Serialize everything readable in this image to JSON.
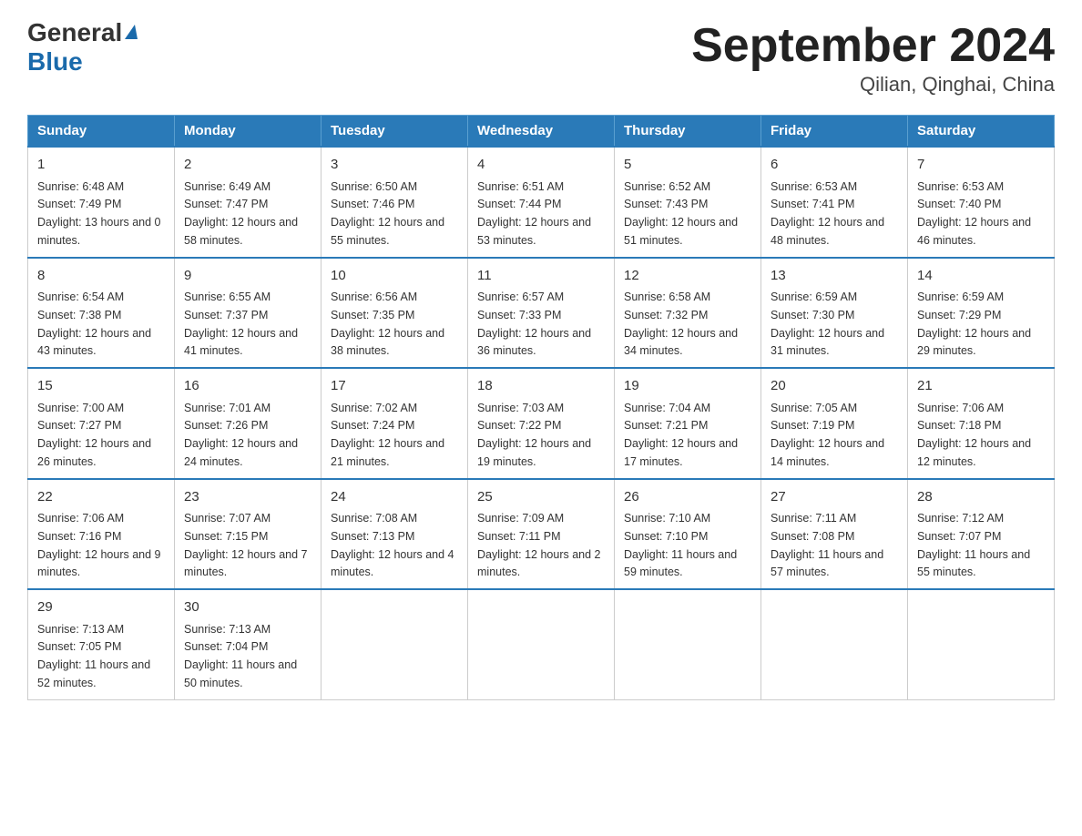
{
  "header": {
    "title": "September 2024",
    "subtitle": "Qilian, Qinghai, China",
    "logo": {
      "general": "General",
      "blue": "Blue"
    }
  },
  "days_of_week": [
    "Sunday",
    "Monday",
    "Tuesday",
    "Wednesday",
    "Thursday",
    "Friday",
    "Saturday"
  ],
  "weeks": [
    [
      {
        "day": "1",
        "sunrise": "6:48 AM",
        "sunset": "7:49 PM",
        "daylight": "13 hours and 0 minutes."
      },
      {
        "day": "2",
        "sunrise": "6:49 AM",
        "sunset": "7:47 PM",
        "daylight": "12 hours and 58 minutes."
      },
      {
        "day": "3",
        "sunrise": "6:50 AM",
        "sunset": "7:46 PM",
        "daylight": "12 hours and 55 minutes."
      },
      {
        "day": "4",
        "sunrise": "6:51 AM",
        "sunset": "7:44 PM",
        "daylight": "12 hours and 53 minutes."
      },
      {
        "day": "5",
        "sunrise": "6:52 AM",
        "sunset": "7:43 PM",
        "daylight": "12 hours and 51 minutes."
      },
      {
        "day": "6",
        "sunrise": "6:53 AM",
        "sunset": "7:41 PM",
        "daylight": "12 hours and 48 minutes."
      },
      {
        "day": "7",
        "sunrise": "6:53 AM",
        "sunset": "7:40 PM",
        "daylight": "12 hours and 46 minutes."
      }
    ],
    [
      {
        "day": "8",
        "sunrise": "6:54 AM",
        "sunset": "7:38 PM",
        "daylight": "12 hours and 43 minutes."
      },
      {
        "day": "9",
        "sunrise": "6:55 AM",
        "sunset": "7:37 PM",
        "daylight": "12 hours and 41 minutes."
      },
      {
        "day": "10",
        "sunrise": "6:56 AM",
        "sunset": "7:35 PM",
        "daylight": "12 hours and 38 minutes."
      },
      {
        "day": "11",
        "sunrise": "6:57 AM",
        "sunset": "7:33 PM",
        "daylight": "12 hours and 36 minutes."
      },
      {
        "day": "12",
        "sunrise": "6:58 AM",
        "sunset": "7:32 PM",
        "daylight": "12 hours and 34 minutes."
      },
      {
        "day": "13",
        "sunrise": "6:59 AM",
        "sunset": "7:30 PM",
        "daylight": "12 hours and 31 minutes."
      },
      {
        "day": "14",
        "sunrise": "6:59 AM",
        "sunset": "7:29 PM",
        "daylight": "12 hours and 29 minutes."
      }
    ],
    [
      {
        "day": "15",
        "sunrise": "7:00 AM",
        "sunset": "7:27 PM",
        "daylight": "12 hours and 26 minutes."
      },
      {
        "day": "16",
        "sunrise": "7:01 AM",
        "sunset": "7:26 PM",
        "daylight": "12 hours and 24 minutes."
      },
      {
        "day": "17",
        "sunrise": "7:02 AM",
        "sunset": "7:24 PM",
        "daylight": "12 hours and 21 minutes."
      },
      {
        "day": "18",
        "sunrise": "7:03 AM",
        "sunset": "7:22 PM",
        "daylight": "12 hours and 19 minutes."
      },
      {
        "day": "19",
        "sunrise": "7:04 AM",
        "sunset": "7:21 PM",
        "daylight": "12 hours and 17 minutes."
      },
      {
        "day": "20",
        "sunrise": "7:05 AM",
        "sunset": "7:19 PM",
        "daylight": "12 hours and 14 minutes."
      },
      {
        "day": "21",
        "sunrise": "7:06 AM",
        "sunset": "7:18 PM",
        "daylight": "12 hours and 12 minutes."
      }
    ],
    [
      {
        "day": "22",
        "sunrise": "7:06 AM",
        "sunset": "7:16 PM",
        "daylight": "12 hours and 9 minutes."
      },
      {
        "day": "23",
        "sunrise": "7:07 AM",
        "sunset": "7:15 PM",
        "daylight": "12 hours and 7 minutes."
      },
      {
        "day": "24",
        "sunrise": "7:08 AM",
        "sunset": "7:13 PM",
        "daylight": "12 hours and 4 minutes."
      },
      {
        "day": "25",
        "sunrise": "7:09 AM",
        "sunset": "7:11 PM",
        "daylight": "12 hours and 2 minutes."
      },
      {
        "day": "26",
        "sunrise": "7:10 AM",
        "sunset": "7:10 PM",
        "daylight": "11 hours and 59 minutes."
      },
      {
        "day": "27",
        "sunrise": "7:11 AM",
        "sunset": "7:08 PM",
        "daylight": "11 hours and 57 minutes."
      },
      {
        "day": "28",
        "sunrise": "7:12 AM",
        "sunset": "7:07 PM",
        "daylight": "11 hours and 55 minutes."
      }
    ],
    [
      {
        "day": "29",
        "sunrise": "7:13 AM",
        "sunset": "7:05 PM",
        "daylight": "11 hours and 52 minutes."
      },
      {
        "day": "30",
        "sunrise": "7:13 AM",
        "sunset": "7:04 PM",
        "daylight": "11 hours and 50 minutes."
      },
      null,
      null,
      null,
      null,
      null
    ]
  ],
  "labels": {
    "sunrise": "Sunrise:",
    "sunset": "Sunset:",
    "daylight": "Daylight:"
  }
}
